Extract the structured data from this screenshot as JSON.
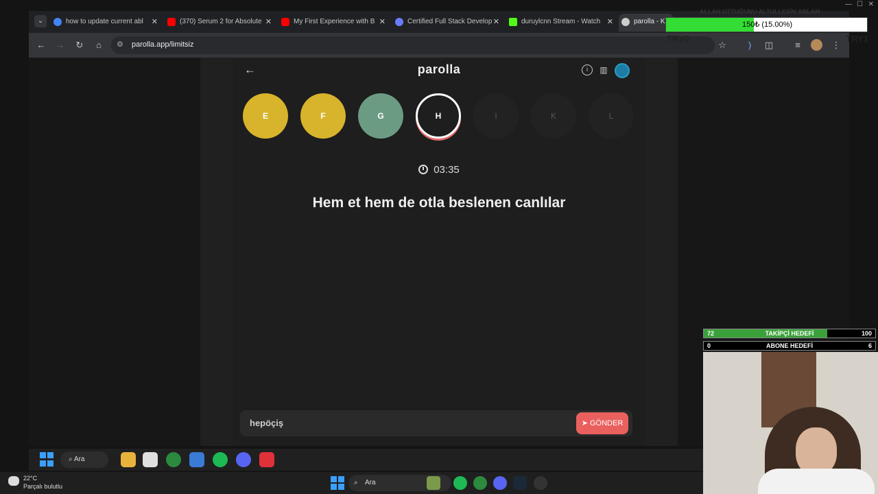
{
  "browser": {
    "tabs": [
      {
        "title": "how to update current abl",
        "color": "#4285f4"
      },
      {
        "title": "(370) Serum 2 for Absolute",
        "color": "#ff0000"
      },
      {
        "title": "My First Experience with B",
        "color": "#ff0000"
      },
      {
        "title": "Certified Full Stack Develop",
        "color": "#6b7cff"
      },
      {
        "title": "duruylcnn Stream - Watch",
        "color": "#53fc18"
      },
      {
        "title": "parolla - K",
        "color": "#cccccc"
      }
    ],
    "url": "parolla.app/limitsiz"
  },
  "app": {
    "brand": "parolla",
    "letters": [
      {
        "letter": "E",
        "state": "done"
      },
      {
        "letter": "F",
        "state": "done"
      },
      {
        "letter": "G",
        "state": "correct"
      },
      {
        "letter": "H",
        "state": "current"
      },
      {
        "letter": "İ",
        "state": "pending"
      },
      {
        "letter": "K",
        "state": "pending"
      },
      {
        "letter": "L",
        "state": "pending"
      }
    ],
    "timer": "03:35",
    "question": "Hem et hem de otla beslenen canlılar",
    "answer": "hepöçiş",
    "send_label": "GÖNDER"
  },
  "overlay": {
    "title": "ALLAH UTTUĞUNU ALTULLESİN ABLAM",
    "donation": "150₺ (15.00%)",
    "donation_progress": 0.15,
    "left_label": "TRY0",
    "right_label": "TRY1",
    "follower_goal": {
      "current": "72",
      "label": "TAKİPÇİ HEDEFİ",
      "target": "100",
      "progress": 0.72
    },
    "sub_goal": {
      "current": "0",
      "label": "ABONE HEDEFİ",
      "target": "6",
      "progress": 0
    }
  },
  "taskbar": {
    "search_label": "Ara",
    "search_label_main": "Ara",
    "temperature": "22°C",
    "weather": "Parçalı bulutlu"
  },
  "colors": {
    "done": "#d8b42c",
    "correct": "#6b9c83",
    "send": "#e9605e"
  }
}
